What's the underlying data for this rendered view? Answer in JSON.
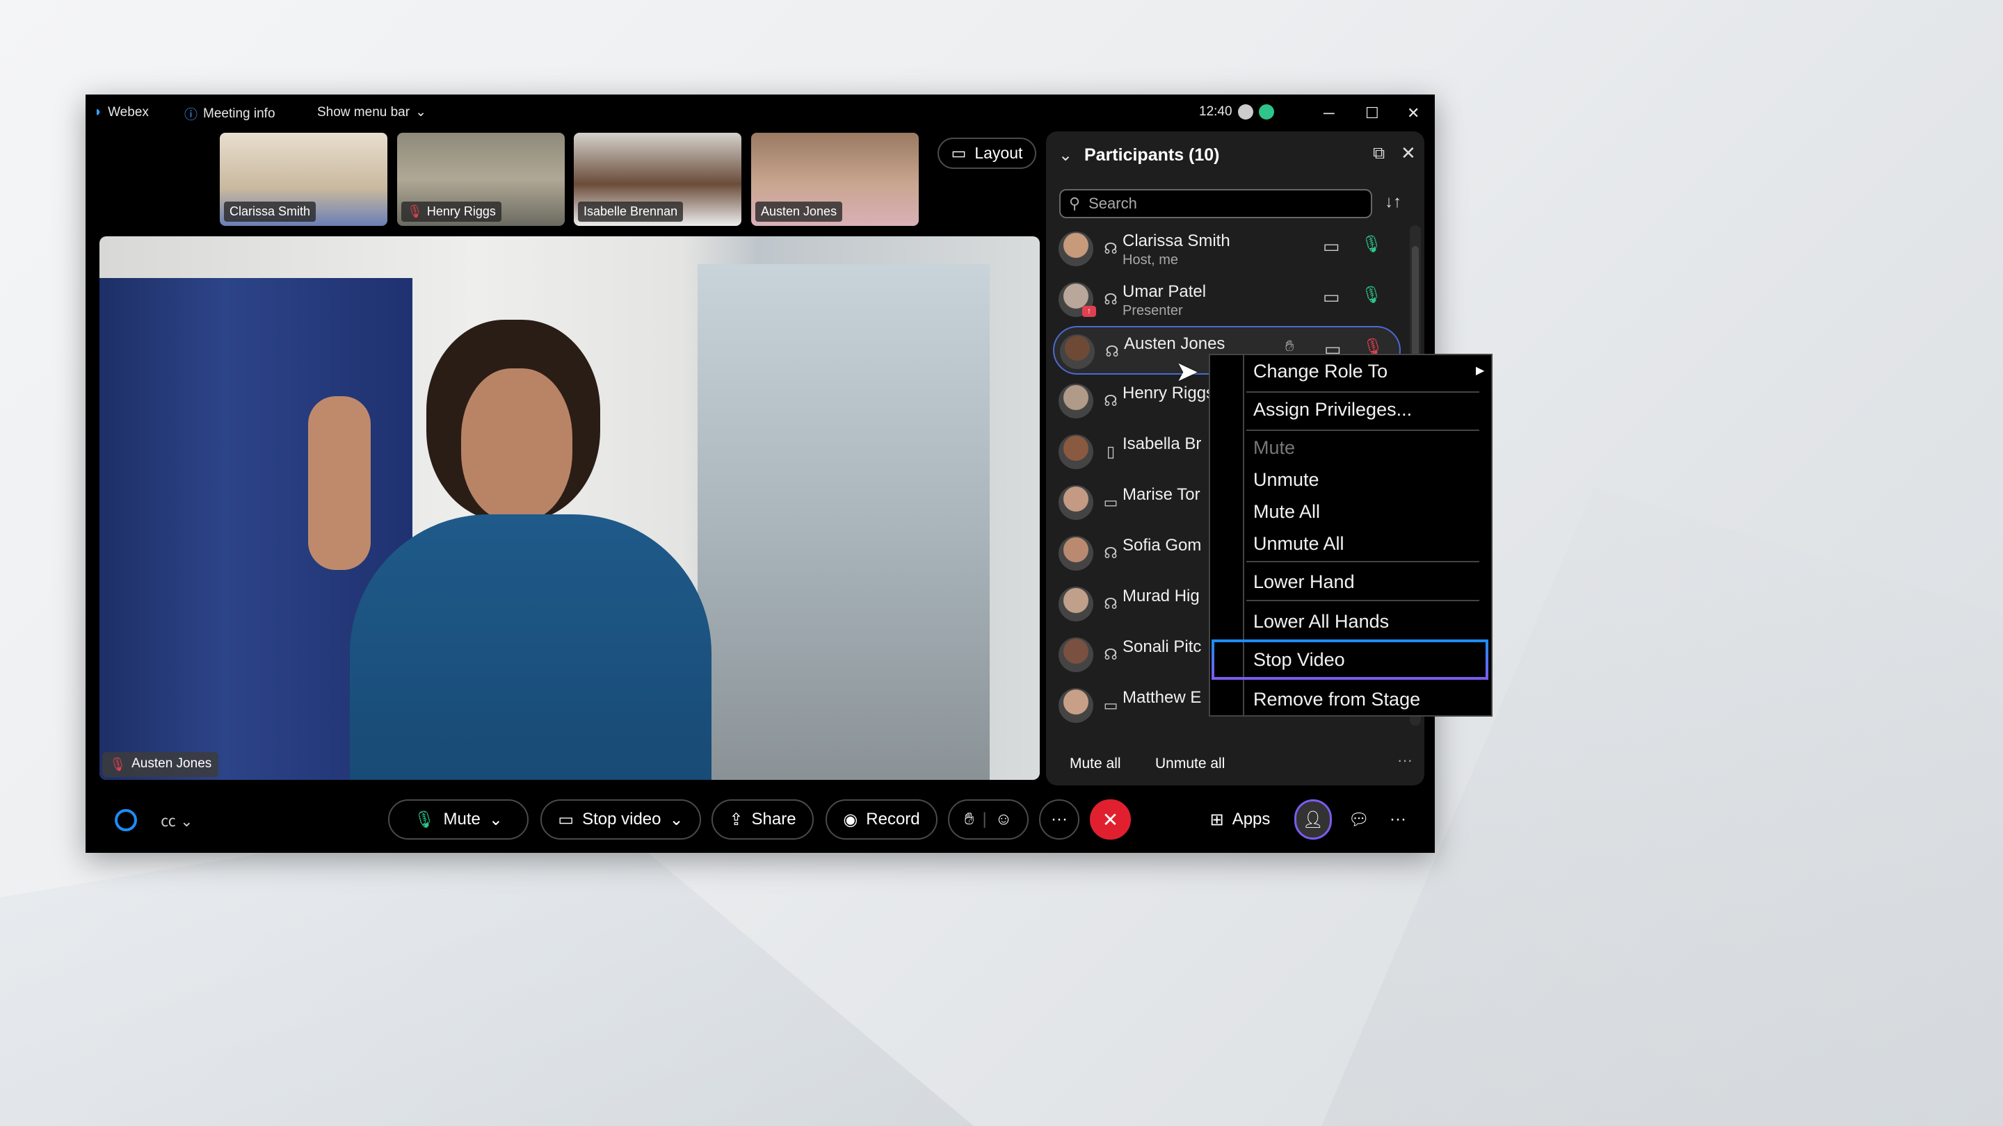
{
  "titlebar": {
    "app": "Webex",
    "meeting_info": "Meeting info",
    "show_menu_bar": "Show menu bar",
    "time": "12:40"
  },
  "thumbnails": [
    {
      "name": "Clarissa Smith",
      "muted": false
    },
    {
      "name": "Henry Riggs",
      "muted": true
    },
    {
      "name": "Isabelle Brennan",
      "muted": false
    },
    {
      "name": "Austen Jones",
      "muted": false
    }
  ],
  "layout_label": "Layout",
  "stage": {
    "speaker": "Austen Jones",
    "muted": true
  },
  "participants": {
    "title": "Participants (10)",
    "search_placeholder": "Search",
    "items": [
      {
        "name": "Clarissa Smith",
        "role": "Host, me",
        "device": "headset",
        "video": true,
        "mic": "on"
      },
      {
        "name": "Umar Patel",
        "role": "Presenter",
        "device": "headset",
        "video": true,
        "mic": "on",
        "badge": "sharing"
      },
      {
        "name": "Austen Jones",
        "role": "",
        "device": "headset",
        "video": true,
        "mic": "muted",
        "hand": true,
        "selected": true
      },
      {
        "name": "Henry Riggs",
        "role": "",
        "device": "headset"
      },
      {
        "name": "Isabella Br",
        "role": "",
        "device": "tablet"
      },
      {
        "name": "Marise Tor",
        "role": "",
        "device": "laptop"
      },
      {
        "name": "Sofia Gom",
        "role": "",
        "device": "headset"
      },
      {
        "name": "Murad Hig",
        "role": "",
        "device": "headset"
      },
      {
        "name": "Sonali Pitc",
        "role": "",
        "device": "headset"
      },
      {
        "name": "Matthew E",
        "role": "",
        "device": "laptop"
      }
    ],
    "mute_all": "Mute all",
    "unmute_all": "Unmute all"
  },
  "context_menu": {
    "items": [
      {
        "label": "Change Role To",
        "submenu": true
      },
      {
        "label": "Assign Privileges..."
      },
      {
        "label": "Mute",
        "disabled": true
      },
      {
        "label": "Unmute"
      },
      {
        "label": "Mute All"
      },
      {
        "label": "Unmute All"
      },
      {
        "label": "Lower Hand"
      },
      {
        "label": "Lower All Hands"
      },
      {
        "label": "Stop Video",
        "focused": true
      },
      {
        "label": "Remove from Stage"
      }
    ]
  },
  "toolbar": {
    "mute": "Mute",
    "stop_video": "Stop video",
    "share": "Share",
    "record": "Record",
    "more": "···",
    "apps": "Apps"
  },
  "colors": {
    "accent": "#1d8cf8",
    "focus": "#7b5cf0",
    "end_call": "#e0202f",
    "mic_on": "#2ec48a",
    "muted": "#e04050"
  }
}
